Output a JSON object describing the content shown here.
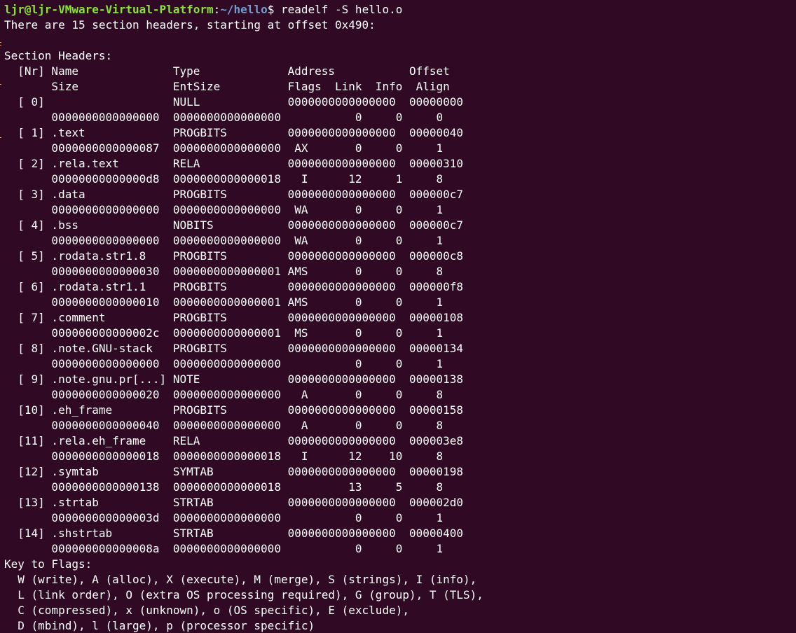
{
  "colors": {
    "background": "#300a24",
    "foreground": "#ffffff",
    "prompt_user": "#8ae234",
    "prompt_path": "#729fcf"
  },
  "prompt": {
    "user_host": "ljr@ljr-VMware-Virtual-Platform",
    "separator": ":",
    "path": "~/hello",
    "symbol": "$ ",
    "command": "readelf -S hello.o"
  },
  "output": {
    "summary": "There are 15 section headers, starting at offset 0x490:",
    "blank": "",
    "section_title": "Section Headers:",
    "header_line1": "  [Nr] Name              Type             Address           Offset",
    "header_line2": "       Size              EntSize          Flags  Link  Info  Align",
    "sections": [
      {
        "line1": "  [ 0]                   NULL             0000000000000000  00000000",
        "line2": "       0000000000000000  0000000000000000           0     0     0"
      },
      {
        "line1": "  [ 1] .text             PROGBITS         0000000000000000  00000040",
        "line2": "       0000000000000087  0000000000000000  AX       0     0     1"
      },
      {
        "line1": "  [ 2] .rela.text        RELA             0000000000000000  00000310",
        "line2": "       00000000000000d8  0000000000000018   I      12     1     8"
      },
      {
        "line1": "  [ 3] .data             PROGBITS         0000000000000000  000000c7",
        "line2": "       0000000000000000  0000000000000000  WA       0     0     1"
      },
      {
        "line1": "  [ 4] .bss              NOBITS           0000000000000000  000000c7",
        "line2": "       0000000000000000  0000000000000000  WA       0     0     1"
      },
      {
        "line1": "  [ 5] .rodata.str1.8    PROGBITS         0000000000000000  000000c8",
        "line2": "       0000000000000030  0000000000000001 AMS       0     0     8"
      },
      {
        "line1": "  [ 6] .rodata.str1.1    PROGBITS         0000000000000000  000000f8",
        "line2": "       0000000000000010  0000000000000001 AMS       0     0     1"
      },
      {
        "line1": "  [ 7] .comment          PROGBITS         0000000000000000  00000108",
        "line2": "       000000000000002c  0000000000000001  MS       0     0     1"
      },
      {
        "line1": "  [ 8] .note.GNU-stack   PROGBITS         0000000000000000  00000134",
        "line2": "       0000000000000000  0000000000000000           0     0     1"
      },
      {
        "line1": "  [ 9] .note.gnu.pr[...] NOTE             0000000000000000  00000138",
        "line2": "       0000000000000020  0000000000000000   A       0     0     8"
      },
      {
        "line1": "  [10] .eh_frame         PROGBITS         0000000000000000  00000158",
        "line2": "       0000000000000040  0000000000000000   A       0     0     8"
      },
      {
        "line1": "  [11] .rela.eh_frame    RELA             0000000000000000  000003e8",
        "line2": "       0000000000000018  0000000000000018   I      12    10     8"
      },
      {
        "line1": "  [12] .symtab           SYMTAB           0000000000000000  00000198",
        "line2": "       0000000000000138  0000000000000018          13     5     8"
      },
      {
        "line1": "  [13] .strtab           STRTAB           0000000000000000  000002d0",
        "line2": "       000000000000003d  0000000000000000           0     0     1"
      },
      {
        "line1": "  [14] .shstrtab         STRTAB           0000000000000000  00000400",
        "line2": "       000000000000008a  0000000000000000           0     0     1"
      }
    ],
    "flags_title": "Key to Flags:",
    "flags_lines": [
      "  W (write), A (alloc), X (execute), M (merge), S (strings), I (info),",
      "  L (link order), O (extra OS processing required), G (group), T (TLS),",
      "  C (compressed), x (unknown), o (OS specific), E (exclude),",
      "  D (mbind), l (large), p (processor specific)"
    ]
  }
}
